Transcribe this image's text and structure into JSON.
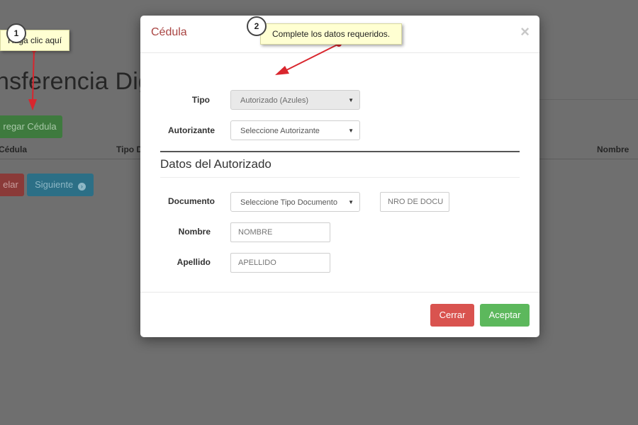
{
  "background": {
    "title": "nsferencia Dig",
    "add_button": "regar Cédula",
    "table_headers": [
      "Cédula",
      "Tipo D",
      "Nombre"
    ],
    "cancel_button": "elar",
    "next_button": "Siguiente"
  },
  "modal": {
    "title": "Cédula",
    "close": "×",
    "fields": {
      "tipo": {
        "label": "Tipo",
        "value": "Autorizado (Azules)"
      },
      "autorizante": {
        "label": "Autorizante",
        "value": "Seleccione Autorizante"
      }
    },
    "section_title": "Datos del Autorizado",
    "documento": {
      "label": "Documento",
      "value": "Seleccione Tipo Documento",
      "number_placeholder": "NRO DE DOCU"
    },
    "nombre": {
      "label": "Nombre",
      "placeholder": "NOMBRE"
    },
    "apellido": {
      "label": "Apellido",
      "placeholder": "APELLIDO"
    },
    "buttons": {
      "cerrar": "Cerrar",
      "aceptar": "Aceptar"
    }
  },
  "tooltips": [
    {
      "step": "1",
      "text": "Haga clic aquí"
    },
    {
      "step": "2",
      "text": "Complete los datos requeridos."
    }
  ],
  "colors": {
    "title_accent": "#a94442",
    "danger": "#d9534f",
    "success": "#5cb85c",
    "tooltip_bg": "#ffffd2",
    "arrow": "#d9262e"
  }
}
